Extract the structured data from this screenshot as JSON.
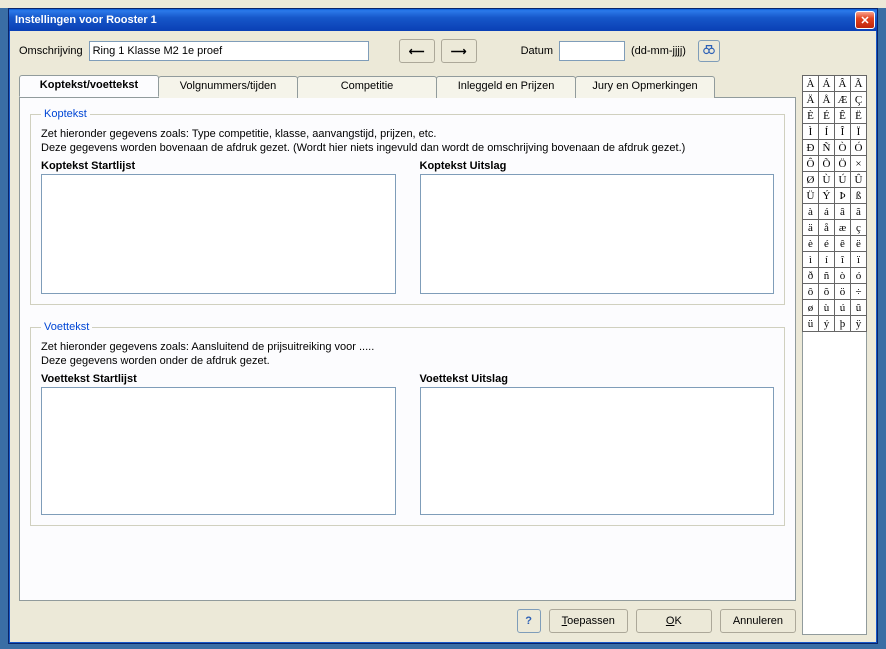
{
  "window": {
    "title": "Instellingen voor Rooster 1"
  },
  "top": {
    "omschrijving_label": "Omschrijving",
    "omschrijving_value": "Ring 1 Klasse M2 1e proef",
    "datum_label": "Datum",
    "datum_value": "",
    "datum_hint": "(dd-mm-jjjj)"
  },
  "tabs": [
    {
      "label": "Koptekst/voettekst",
      "active": true
    },
    {
      "label": "Volgnummers/tijden",
      "active": false
    },
    {
      "label": "Competitie",
      "active": false
    },
    {
      "label": "Inleggeld en Prijzen",
      "active": false
    },
    {
      "label": "Jury en Opmerkingen",
      "active": false
    }
  ],
  "koptekst": {
    "legend": "Koptekst",
    "line1": "Zet hieronder gegevens zoals: Type competitie, klasse, aanvangstijd, prijzen, etc.",
    "line2": "Deze gegevens worden bovenaan de afdruk gezet. (Wordt hier niets ingevuld dan wordt de omschrijving bovenaan de afdruk gezet.)",
    "left_label": "Koptekst Startlijst",
    "left_value": "",
    "right_label": "Koptekst Uitslag",
    "right_value": ""
  },
  "voettekst": {
    "legend": "Voettekst",
    "line1": "Zet hieronder gegevens zoals: Aansluitend de prijsuitreiking voor .....",
    "line2": "Deze gegevens worden onder de afdruk gezet.",
    "left_label": "Voettekst Startlijst",
    "left_value": "",
    "right_label": "Voettekst Uitslag",
    "right_value": ""
  },
  "buttons": {
    "toepassen": "Toepassen",
    "ok": "OK",
    "annuleren": "Annuleren"
  },
  "chars": [
    "À",
    "Á",
    "Â",
    "Ã",
    "Ä",
    "Å",
    "Æ",
    "Ç",
    "È",
    "É",
    "Ê",
    "Ë",
    "Ì",
    "Í",
    "Î",
    "Ï",
    "Ð",
    "Ñ",
    "Ò",
    "Ó",
    "Ô",
    "Õ",
    "Ö",
    "×",
    "Ø",
    "Ù",
    "Ú",
    "Û",
    "Ü",
    "Ý",
    "Þ",
    "ß",
    "à",
    "á",
    "â",
    "ã",
    "ä",
    "å",
    "æ",
    "ç",
    "è",
    "é",
    "ê",
    "ë",
    "ì",
    "í",
    "î",
    "ï",
    "ð",
    "ñ",
    "ò",
    "ó",
    "ô",
    "õ",
    "ö",
    "÷",
    "ø",
    "ù",
    "ú",
    "û",
    "ü",
    "ý",
    "þ",
    "ÿ"
  ]
}
